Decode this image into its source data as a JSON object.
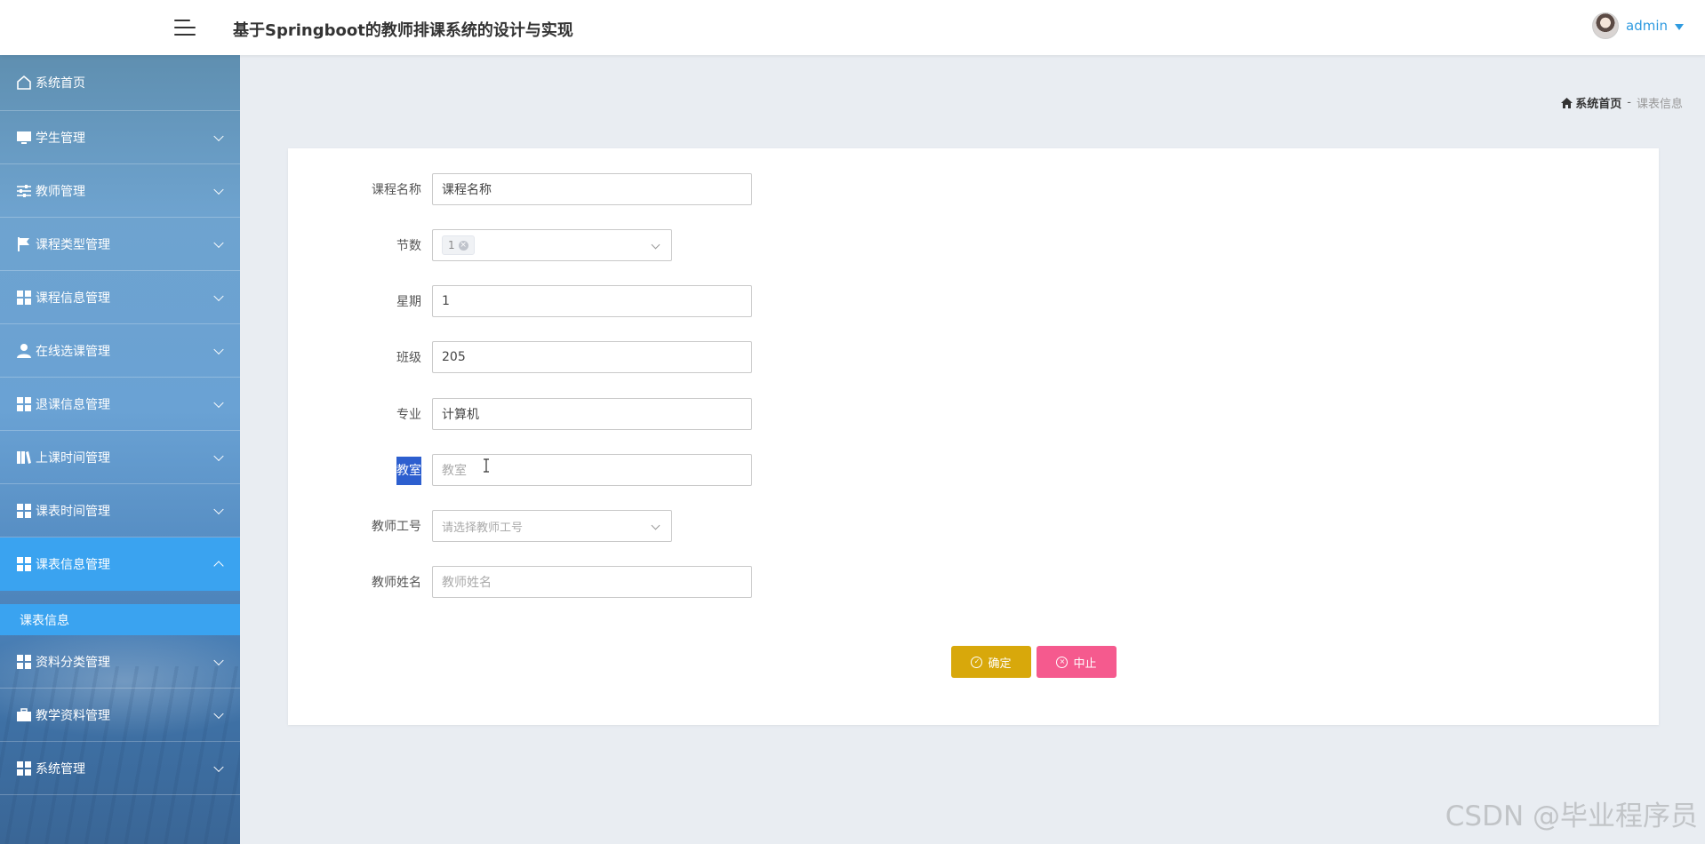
{
  "header": {
    "title": "基于Springboot的教师排课系统的设计与实现",
    "user_name": "admin"
  },
  "sidebar": {
    "items": [
      {
        "label": "系统首页",
        "icon": "home-icon"
      },
      {
        "label": "学生管理",
        "icon": "monitor-icon"
      },
      {
        "label": "教师管理",
        "icon": "sliders-icon"
      },
      {
        "label": "课程类型管理",
        "icon": "flag-icon"
      },
      {
        "label": "课程信息管理",
        "icon": "grid-icon"
      },
      {
        "label": "在线选课管理",
        "icon": "user-icon"
      },
      {
        "label": "退课信息管理",
        "icon": "grid-icon"
      },
      {
        "label": "上课时间管理",
        "icon": "book-icon"
      },
      {
        "label": "课表时间管理",
        "icon": "grid-icon"
      },
      {
        "label": "课表信息管理",
        "icon": "grid-icon",
        "active": true
      },
      {
        "label": "资料分类管理",
        "icon": "grid-icon"
      },
      {
        "label": "教学资料管理",
        "icon": "briefcase-icon"
      },
      {
        "label": "系统管理",
        "icon": "grid-icon"
      }
    ],
    "submenu": {
      "label": "课表信息"
    }
  },
  "breadcrumb": {
    "home": "系统首页",
    "separator": "-",
    "current": "课表信息"
  },
  "form": {
    "course_name": {
      "label": "课程名称",
      "value": "课程名称"
    },
    "section": {
      "label": "节数",
      "tag": "1"
    },
    "weekday": {
      "label": "星期",
      "value": "1"
    },
    "class": {
      "label": "班级",
      "value": "205"
    },
    "major": {
      "label": "专业",
      "value": "计算机"
    },
    "classroom": {
      "label": "教室",
      "placeholder": "教室"
    },
    "teacher_id": {
      "label": "教师工号",
      "placeholder": "请选择教师工号"
    },
    "teacher_name": {
      "label": "教师姓名",
      "placeholder": "教师姓名"
    }
  },
  "buttons": {
    "confirm": "确定",
    "stop": "中止"
  },
  "watermark": "CSDN @毕业程序员",
  "colors": {
    "accent": "#3aa3f0",
    "confirm": "#d8a80b",
    "stop": "#f55a8e",
    "user": "#2f9be0"
  }
}
